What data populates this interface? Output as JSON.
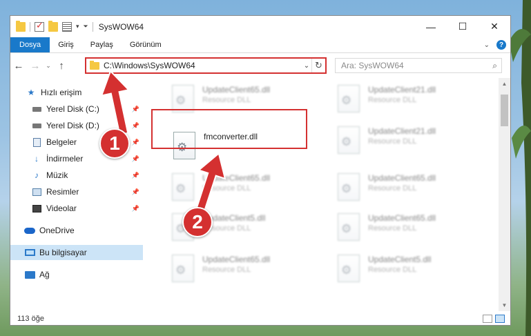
{
  "window": {
    "title": "SysWOW64",
    "controls": {
      "minimize": "—",
      "maximize": "☐",
      "close": "✕"
    }
  },
  "ribbon": {
    "tabs": [
      {
        "label": "Dosya",
        "active": true
      },
      {
        "label": "Giriş"
      },
      {
        "label": "Paylaş"
      },
      {
        "label": "Görünüm"
      }
    ],
    "accent": "#1979ca"
  },
  "address": {
    "path": "C:\\Windows\\SysWOW64",
    "search_placeholder": "Ara: SysWOW64"
  },
  "sidebar": {
    "items": [
      {
        "label": "Hızlı erişim",
        "icon": "star-icon"
      },
      {
        "label": "Yerel Disk (C:)",
        "icon": "drive-icon",
        "pinned": true
      },
      {
        "label": "Yerel Disk (D:)",
        "icon": "drive-icon",
        "pinned": true
      },
      {
        "label": "Belgeler",
        "icon": "document-icon",
        "pinned": true
      },
      {
        "label": "İndirmeler",
        "icon": "download-icon",
        "pinned": true
      },
      {
        "label": "Müzik",
        "icon": "music-icon",
        "pinned": true
      },
      {
        "label": "Resimler",
        "icon": "pictures-icon",
        "pinned": true
      },
      {
        "label": "Videolar",
        "icon": "videos-icon",
        "pinned": true
      },
      {
        "label": "OneDrive",
        "icon": "cloud-icon"
      },
      {
        "label": "Bu bilgisayar",
        "icon": "computer-icon",
        "selected": true
      },
      {
        "label": "Ağ",
        "icon": "network-icon"
      }
    ]
  },
  "files": {
    "highlighted": {
      "name": "fmconverter.dll"
    },
    "blurred": [
      {
        "name": "UpdateClient65.dll",
        "type": "Resource DLL"
      },
      {
        "name": "UpdateClient21.dll",
        "type": "Resource DLL"
      },
      {
        "name": "UpdateClient21.dll",
        "type": "Resource DLL"
      },
      {
        "name": "UpdateClient65.dll",
        "type": "Resource DLL"
      },
      {
        "name": "UpdateClient65.dll",
        "type": "Resource DLL"
      },
      {
        "name": "UpdateClient5.dll",
        "type": "Resource DLL"
      },
      {
        "name": "UpdateClient65.dll",
        "type": "Resource DLL"
      },
      {
        "name": "UpdateClient65.dll",
        "type": "Resource DLL"
      },
      {
        "name": "UpdateClient5.dll",
        "type": "Resource DLL"
      }
    ]
  },
  "status": {
    "count": "113 öğe"
  },
  "annotations": {
    "step1": "1",
    "step2": "2",
    "color": "#d43030"
  }
}
